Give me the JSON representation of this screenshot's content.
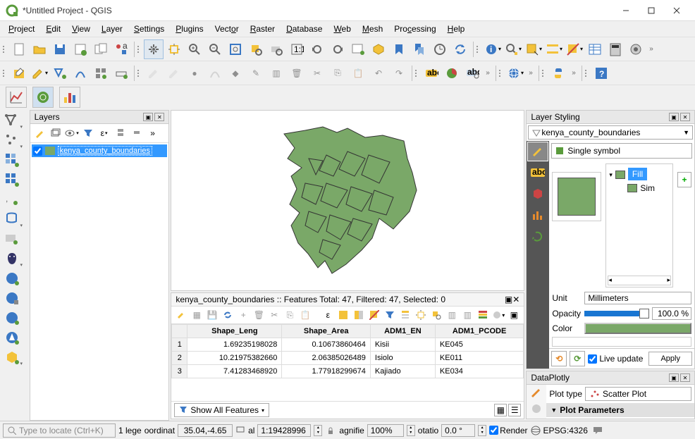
{
  "title": "*Untitled Project - QGIS",
  "menus": [
    "Project",
    "Edit",
    "View",
    "Layer",
    "Settings",
    "Plugins",
    "Vector",
    "Raster",
    "Database",
    "Web",
    "Mesh",
    "Processing",
    "Help"
  ],
  "layers_panel": {
    "title": "Layers",
    "layer": {
      "name": "kenya_county_boundaries",
      "visible": true,
      "fill": "#7aa868"
    }
  },
  "attribute_table": {
    "title": "kenya_county_boundaries :: Features Total: 47, Filtered: 47, Selected: 0",
    "columns": [
      "Shape_Leng",
      "Shape_Area",
      "ADM1_EN",
      "ADM1_PCODE"
    ],
    "rows": [
      {
        "n": 1,
        "Shape_Leng": "1.69235198028",
        "Shape_Area": "0.10673860464",
        "ADM1_EN": "Kisii",
        "ADM1_PCODE": "KE045"
      },
      {
        "n": 2,
        "Shape_Leng": "10.21975382660",
        "Shape_Area": "2.06385026489",
        "ADM1_EN": "Isiolo",
        "ADM1_PCODE": "KE011"
      },
      {
        "n": 3,
        "Shape_Leng": "7.41283468920",
        "Shape_Area": "1.77918299674",
        "ADM1_EN": "Kajiado",
        "ADM1_PCODE": "KE034"
      }
    ],
    "show_all": "Show All Features"
  },
  "styling": {
    "title": "Layer Styling",
    "layer": "kenya_county_boundaries",
    "mode": "Single symbol",
    "fill_label": "Fill",
    "sim_label": "Sim",
    "unit_label": "Unit",
    "unit_value": "Millimeters",
    "opacity_label": "Opacity",
    "opacity_value": "100.0 %",
    "color_label": "Color",
    "live_update": "Live update",
    "apply": "Apply"
  },
  "plotly": {
    "title": "DataPlotly",
    "plot_type_label": "Plot type",
    "plot_type_value": "Scatter Plot",
    "section": "Plot Parameters"
  },
  "status": {
    "locator_placeholder": "Type to locate (Ctrl+K)",
    "legend": "1 lege",
    "coord_label": "oordinat",
    "coord_value": "35.04,-4.65",
    "scale_label": "al",
    "scale_value": "1:19428996",
    "mag_label": "agnifie",
    "mag_value": "100%",
    "rot_label": "otatio",
    "rot_value": "0.0 °",
    "render": "Render",
    "proj": "EPSG:4326"
  },
  "colors": {
    "accent": "#3399ff",
    "fill": "#7aa868"
  }
}
